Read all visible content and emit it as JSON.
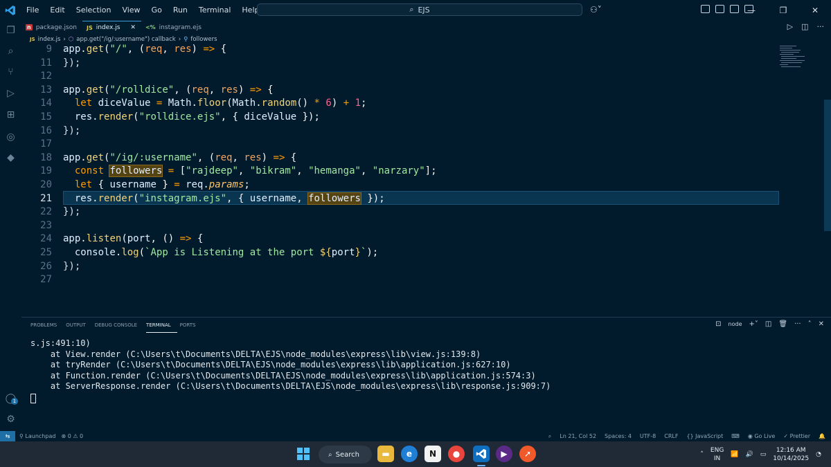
{
  "titlebar": {
    "menu": [
      "File",
      "Edit",
      "Selection",
      "View",
      "Go",
      "Run",
      "Terminal",
      "Help"
    ],
    "search_text": "EJS"
  },
  "tabs": [
    {
      "icon": "npm-icon",
      "label": "package.json",
      "active": false
    },
    {
      "icon": "js-file-icon",
      "prefix": "JS",
      "label": "index.js",
      "active": true
    },
    {
      "icon": "ejs-file-icon",
      "prefix": "<%",
      "label": "instagram.ejs",
      "active": false
    }
  ],
  "breadcrumb": {
    "file_prefix": "JS",
    "file": "index.js",
    "callback": "app.get(\"/ig/:username\") callback",
    "symbol": "followers"
  },
  "editor": {
    "current_line": 21,
    "lines": [
      {
        "n": "9",
        "text": "app.get(\"/\", (req, res) => {"
      },
      {
        "n": "11",
        "text": "});"
      },
      {
        "n": "12",
        "text": ""
      },
      {
        "n": "13",
        "text": "app.get(\"/rolldice\", (req, res) => {"
      },
      {
        "n": "14",
        "text": "  let diceValue = Math.floor(Math.random() * 6) + 1;"
      },
      {
        "n": "15",
        "text": "  res.render(\"rolldice.ejs\", { diceValue });"
      },
      {
        "n": "16",
        "text": "});"
      },
      {
        "n": "17",
        "text": ""
      },
      {
        "n": "18",
        "text": "app.get(\"/ig/:username\", (req, res) => {"
      },
      {
        "n": "19",
        "text": "  const followers = [\"rajdeep\", \"bikram\", \"hemanga\", \"narzary\"];"
      },
      {
        "n": "20",
        "text": "  let { username } = req.params;"
      },
      {
        "n": "21",
        "text": "  res.render(\"instagram.ejs\", { username, followers });"
      },
      {
        "n": "22",
        "text": "});"
      },
      {
        "n": "23",
        "text": ""
      },
      {
        "n": "24",
        "text": "app.listen(port, () => {"
      },
      {
        "n": "25",
        "text": "  console.log(`App is Listening at the port ${port}`);"
      },
      {
        "n": "26",
        "text": "});"
      },
      {
        "n": "27",
        "text": ""
      }
    ]
  },
  "panel": {
    "tabs": [
      "PROBLEMS",
      "OUTPUT",
      "DEBUG CONSOLE",
      "TERMINAL",
      "PORTS"
    ],
    "active_tab": "TERMINAL",
    "terminal_name": "node",
    "terminal_lines": [
      "s.js:491:10)",
      "    at View.render (C:\\Users\\t\\Documents\\DELTA\\EJS\\node_modules\\express\\lib\\view.js:139:8)",
      "    at tryRender (C:\\Users\\t\\Documents\\DELTA\\EJS\\node_modules\\express\\lib\\application.js:627:10)",
      "    at Function.render (C:\\Users\\t\\Documents\\DELTA\\EJS\\node_modules\\express\\lib\\application.js:574:3)",
      "    at ServerResponse.render (C:\\Users\\t\\Documents\\DELTA\\EJS\\node_modules\\express\\lib\\response.js:909:7)"
    ]
  },
  "statusbar": {
    "launchpad": "Launchpad",
    "errors": "0",
    "warnings": "0",
    "position": "Ln 21, Col 52",
    "spaces": "Spaces: 4",
    "encoding": "UTF-8",
    "eol": "CRLF",
    "language": "JavaScript",
    "golive": "Go Live",
    "prettier": "Prettier"
  },
  "taskbar": {
    "search_label": "Search",
    "lang_top": "ENG",
    "lang_bottom": "IN",
    "time": "12:16 AM",
    "date": "10/14/2025"
  },
  "activity_badge": "1"
}
